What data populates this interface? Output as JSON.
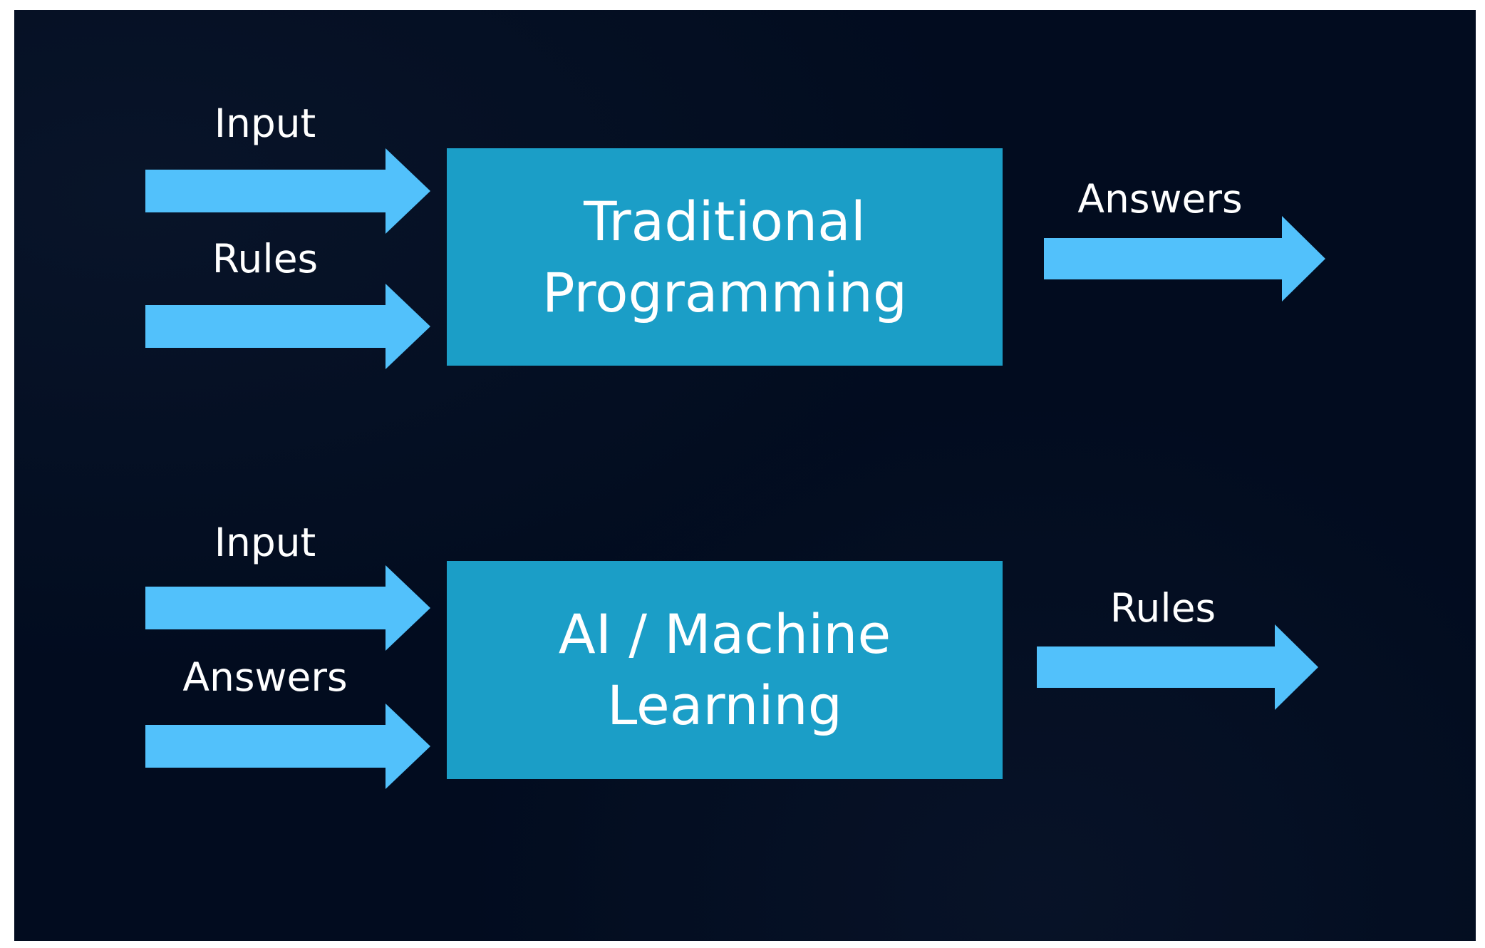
{
  "colors": {
    "background": "#020c1f",
    "box_fill": "#1b9ec7",
    "arrow_fill": "#52c1fb",
    "text": "#ffffff"
  },
  "top_row": {
    "box_line1": "Traditional",
    "box_line2": "Programming",
    "input1_label": "Input",
    "input2_label": "Rules",
    "output_label": "Answers"
  },
  "bottom_row": {
    "box_line1": "AI / Machine",
    "box_line2": "Learning",
    "input1_label": "Input",
    "input2_label": "Answers",
    "output_label": "Rules"
  },
  "icons": {
    "arrow": "arrow-right-icon"
  }
}
